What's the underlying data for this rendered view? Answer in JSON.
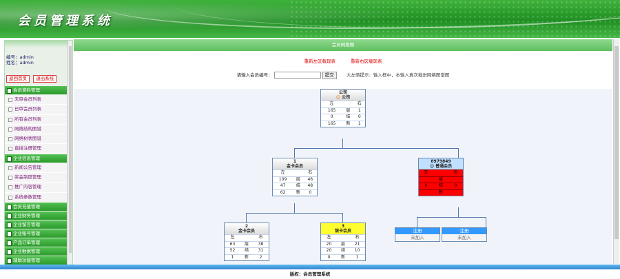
{
  "header": {
    "title": "会员管理系统"
  },
  "sidebar": {
    "user_no": "编号：admin",
    "user_name": "姓名：admin",
    "buttons": [
      "返回首页",
      "退出系统"
    ],
    "sections": [
      {
        "title": "会员资料管理",
        "items": [
          "未审会员列表",
          "已审会员列表",
          "所有会员列表",
          "网络结构图谱",
          "网络树状图谱",
          "直接注册管理"
        ]
      },
      {
        "title": "企业信息管理",
        "items": [
          "新闻公告管理",
          "奖金制度管理",
          "推广内容管理",
          "系统参数管理"
        ]
      },
      {
        "title": "会员充值管理",
        "items": []
      },
      {
        "title": "企业财务管理",
        "items": []
      },
      {
        "title": "企业留言管理",
        "items": []
      },
      {
        "title": "企业账号管理",
        "items": []
      },
      {
        "title": "产品订单管理",
        "items": []
      },
      {
        "title": "企业数据管理",
        "items": []
      },
      {
        "title": "辅助功能管理",
        "items": []
      }
    ]
  },
  "main": {
    "title": "会员网络图",
    "link_left": "重新左区载现表",
    "link_right": "重新右区载现表",
    "search_label": "请输入会员编号：",
    "search_button": "提交",
    "search_tip": "大左情提示：输入框中，本输入真次载进网络图谱图"
  },
  "tree": {
    "root": {
      "id": "公司",
      "level": "公司",
      "icon": "☺",
      "rows": [
        [
          "左",
          "",
          "右"
        ],
        [
          "165",
          "层",
          "1"
        ],
        [
          "0",
          "结",
          "0"
        ],
        [
          "165",
          "新",
          "1"
        ]
      ]
    },
    "n1": {
      "id": "1",
      "level": "金卡会员",
      "rows": [
        [
          "左",
          "",
          "右"
        ],
        [
          "109",
          "层",
          "46"
        ],
        [
          "47",
          "结",
          "48"
        ],
        [
          "62",
          "新",
          "0"
        ]
      ]
    },
    "n2": {
      "id": "8979849",
      "level": "普通会员",
      "icon": "☺",
      "rows": [
        [
          "左",
          "",
          "右"
        ],
        [
          "",
          "层",
          ""
        ],
        [
          "0",
          "结",
          "0"
        ],
        [
          "",
          "新",
          ""
        ]
      ]
    },
    "n3": {
      "id": "2",
      "level": "金卡会员",
      "rows": [
        [
          "左",
          "",
          "右"
        ],
        [
          "63",
          "层",
          "38"
        ],
        [
          "52",
          "结",
          "31"
        ],
        [
          "1",
          "新",
          "2"
        ]
      ]
    },
    "n4": {
      "id": "3",
      "level": "银卡会员",
      "rows": [
        [
          "左",
          "",
          "右"
        ],
        [
          "20",
          "层",
          "21"
        ],
        [
          "20",
          "结",
          "10"
        ],
        [
          "0",
          "新",
          "1"
        ]
      ]
    },
    "reg1": {
      "label": "注册",
      "sub": "未加入"
    },
    "reg2": {
      "label": "注册",
      "sub": "未加入"
    }
  },
  "footer": {
    "text": "版权：会员管理系统"
  },
  "colors": {
    "header_green": "#1f8f22",
    "menu_green": "#2b9a2b",
    "link_red": "#dd0000",
    "register_blue": "#3399ff",
    "footer_blue": "#2e86d0"
  }
}
